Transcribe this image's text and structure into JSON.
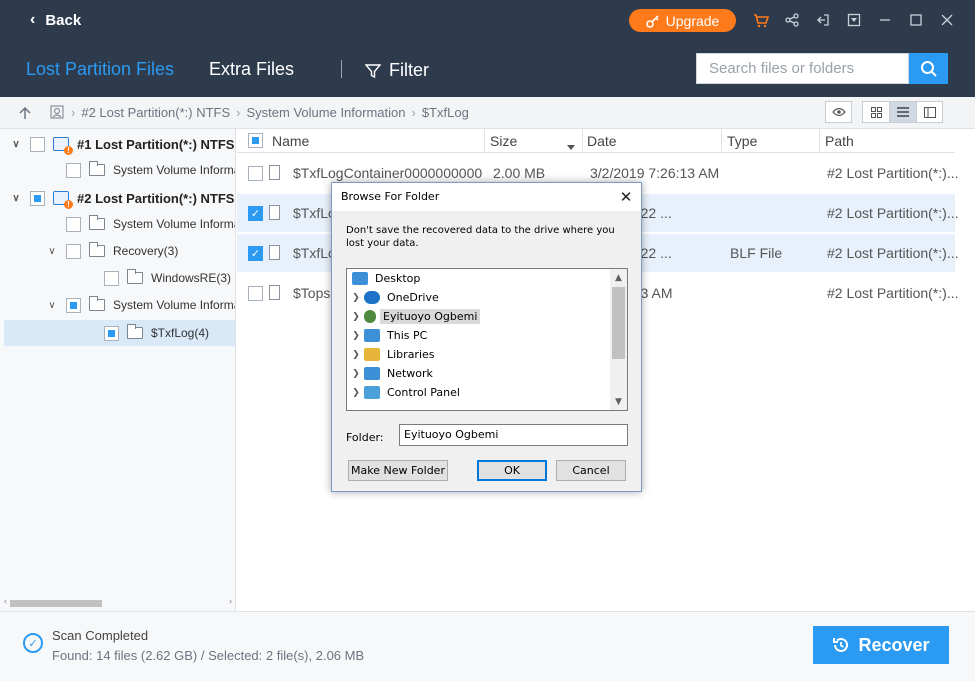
{
  "titlebar": {
    "back_label": "Back",
    "upgrade_label": "Upgrade",
    "icons": [
      "cart-icon",
      "share-icon",
      "sign-out-icon",
      "dropdown-icon",
      "minimize-icon",
      "maximize-icon",
      "close-icon"
    ]
  },
  "tabs": [
    {
      "label": "Lost Partition Files",
      "active": true
    },
    {
      "label": "Extra Files",
      "active": false
    }
  ],
  "filter_label": "Filter",
  "search": {
    "placeholder": "Search files or folders"
  },
  "breadcrumb": [
    "#2 Lost Partition(*:) NTFS",
    "System Volume Information",
    "$TxfLog"
  ],
  "tree": {
    "nodes": [
      {
        "label": "#1 Lost Partition(*:) NTFS",
        "expander": "∨",
        "check": "none",
        "kind": "partition"
      },
      {
        "label": "System Volume Informat",
        "expander": "",
        "check": "none",
        "kind": "folder"
      },
      {
        "label": "#2 Lost Partition(*:) NTFS",
        "expander": "∨",
        "check": "partial",
        "kind": "partition"
      },
      {
        "label": "System Volume Informat",
        "expander": "",
        "check": "none",
        "kind": "folder"
      },
      {
        "label": "Recovery(3)",
        "expander": "∨",
        "check": "none",
        "kind": "folder"
      },
      {
        "label": "WindowsRE(3)",
        "expander": "",
        "check": "none",
        "kind": "folder"
      },
      {
        "label": "System Volume Informat",
        "expander": "∨",
        "check": "partial",
        "kind": "folder"
      },
      {
        "label": "$TxfLog(4)",
        "expander": "",
        "check": "partial",
        "kind": "folder"
      }
    ]
  },
  "list": {
    "columns": [
      "Name",
      "Size",
      "Date",
      "Type",
      "Path"
    ],
    "rows": [
      {
        "name": "$TxfLogContainer0000000000...",
        "size": "2.00 MB",
        "date": "3/2/2019 7:26:13 AM",
        "type": "",
        "path": "#2 Lost Partition(*:)...",
        "checked": false
      },
      {
        "name": "$TxfLog",
        "size": "",
        "date": "19 9:02:22 ...",
        "type": "",
        "path": "#2 Lost Partition(*:)...",
        "checked": true
      },
      {
        "name": "$TxfLog",
        "size": "",
        "date": "19 9:02:22 ...",
        "type": "BLF File",
        "path": "#2 Lost Partition(*:)...",
        "checked": true
      },
      {
        "name": "$Tops",
        "size": "",
        "date": "9 7:26:13 AM",
        "type": "",
        "path": "#2 Lost Partition(*:)...",
        "checked": false
      }
    ]
  },
  "status": {
    "title": "Scan Completed",
    "detail": "Found: 14 files (2.62 GB) / Selected: 2 file(s), 2.06 MB",
    "recover_label": "Recover"
  },
  "dialog": {
    "title": "Browse For Folder",
    "message": "Don't save the recovered data to the drive where you lost your data.",
    "tree": [
      {
        "label": "Desktop",
        "level": 0,
        "icon": "desktop-icon",
        "color": "#3d8fd8",
        "selected": false
      },
      {
        "label": "OneDrive",
        "level": 1,
        "icon": "cloud-icon",
        "color": "#1e73c8",
        "selected": false
      },
      {
        "label": "Eyituoyo Ogbemi",
        "level": 1,
        "icon": "user-icon",
        "color": "#4f8a3f",
        "selected": true
      },
      {
        "label": "This PC",
        "level": 1,
        "icon": "computer-icon",
        "color": "#3d8fd8",
        "selected": false
      },
      {
        "label": "Libraries",
        "level": 1,
        "icon": "library-icon",
        "color": "#e7b43a",
        "selected": false
      },
      {
        "label": "Network",
        "level": 1,
        "icon": "network-icon",
        "color": "#3d8fd8",
        "selected": false
      },
      {
        "label": "Control Panel",
        "level": 1,
        "icon": "control-panel-icon",
        "color": "#4aa0d9",
        "selected": false
      }
    ],
    "folder_label": "Folder:",
    "folder_value": "Eyituoyo Ogbemi",
    "make_new_folder": "Make New Folder",
    "ok": "OK",
    "cancel": "Cancel"
  },
  "colors": {
    "header_bg": "#2e3b4c",
    "accent": "#2b9af3",
    "upgrade": "#ff7a1a"
  }
}
